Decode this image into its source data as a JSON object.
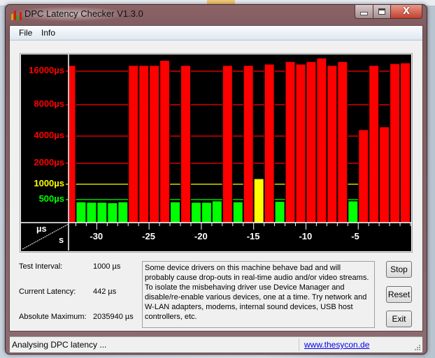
{
  "window": {
    "title": "DPC Latency Checker V1.3.0",
    "controls": {
      "minimize": "▁",
      "maximize": "▢",
      "close": "X"
    }
  },
  "menu": {
    "items": [
      "File",
      "Info"
    ]
  },
  "colors": {
    "red": "#ff0000",
    "green": "#00ff00",
    "yellow": "#ffff00",
    "chart_bg": "#000000",
    "axis": "#ffffff"
  },
  "chart_data": {
    "type": "bar",
    "title": "",
    "xlabel": "s",
    "ylabel": "µs",
    "y_ticks": [
      {
        "value": 16000,
        "label": "16000µs",
        "color": "#ff0000"
      },
      {
        "value": 8000,
        "label": "8000µs",
        "color": "#ff0000"
      },
      {
        "value": 4000,
        "label": "4000µs",
        "color": "#ff0000"
      },
      {
        "value": 2000,
        "label": "2000µs",
        "color": "#ff0000"
      },
      {
        "value": 1000,
        "label": "1000µs",
        "color": "#ffff00"
      },
      {
        "value": 500,
        "label": "500µs",
        "color": "#00ff00"
      }
    ],
    "x_ticks": [
      "-30",
      "-25",
      "-20",
      "-15",
      "-10",
      "-5"
    ],
    "x_tick_values": [
      -30,
      -25,
      -20,
      -15,
      -10,
      -5
    ],
    "x_range": [
      -32.7,
      0
    ],
    "grid": true,
    "values": [
      18000,
      450,
      440,
      440,
      430,
      450,
      18000,
      18000,
      18000,
      20000,
      450,
      18000,
      440,
      440,
      470,
      18000,
      450,
      18000,
      1200,
      18500,
      460,
      19500,
      18500,
      19500,
      21000,
      18000,
      19500,
      470,
      4600,
      18000,
      4900,
      18700,
      19000
    ],
    "x_values": [
      -32.5,
      -31.5,
      -30.5,
      -29.5,
      -28.5,
      -27.5,
      -26.5,
      -25.5,
      -24.5,
      -23.5,
      -22.5,
      -21.5,
      -20.5,
      -19.5,
      -18.5,
      -17.5,
      -16.5,
      -15.5,
      -14.5,
      -13.5,
      -12.5,
      -11.5,
      -10.5,
      -9.5,
      -8.5,
      -7.5,
      -6.5,
      -5.5,
      -4.5,
      -3.5,
      -2.5,
      -1.5,
      -0.5
    ]
  },
  "chart_corner": {
    "top": "µs",
    "bottom": "s"
  },
  "info": {
    "test_interval_label": "Test Interval:",
    "test_interval_value": "1000 µs",
    "current_latency_label": "Current Latency:",
    "current_latency_value": "442 µs",
    "absolute_max_label": "Absolute Maximum:",
    "absolute_max_value": "2035940 µs"
  },
  "message": "Some device drivers on this machine behave bad and will probably cause drop-outs in real-time audio and/or video streams. To isolate the misbehaving driver use Device Manager and disable/re-enable various devices, one at a time. Try network and W-LAN adapters, modems, internal sound devices, USB host controllers, etc.",
  "buttons": {
    "stop": "Stop",
    "reset": "Reset",
    "exit": "Exit"
  },
  "status": {
    "text": "Analysing DPC latency ...",
    "link": "www.thesycon.de"
  },
  "background_strip": {
    "cells": [
      "1",
      "2"
    ]
  }
}
